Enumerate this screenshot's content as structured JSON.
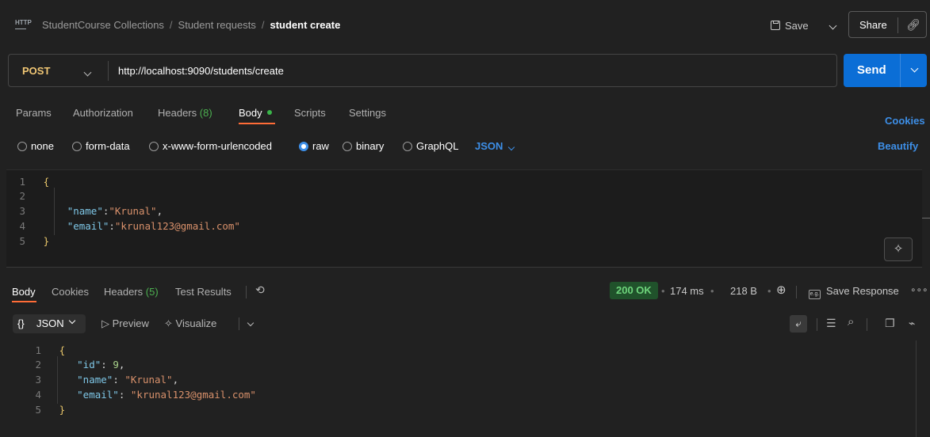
{
  "breadcrumb": {
    "icon_text": "HTTP",
    "collection": "StudentCourse Collections",
    "separator": "/",
    "folder": "Student requests",
    "current": "student create"
  },
  "top_actions": {
    "save_label": "Save",
    "share_label": "Share"
  },
  "request": {
    "method": "POST",
    "url": "http://localhost:9090/students/create",
    "send_label": "Send"
  },
  "request_tabs": [
    {
      "label": "Params"
    },
    {
      "label": "Authorization"
    },
    {
      "label": "Headers",
      "count": "(8)"
    },
    {
      "label": "Body",
      "active": true
    },
    {
      "label": "Scripts"
    },
    {
      "label": "Settings"
    }
  ],
  "cookies_label": "Cookies",
  "body_types": {
    "none": "none",
    "form_data": "form-data",
    "urlencoded": "x-www-form-urlencoded",
    "raw": "raw",
    "binary": "binary",
    "graphql": "GraphQL",
    "selected": "raw",
    "language": "JSON"
  },
  "beautify_label": "Beautify",
  "request_body": {
    "line_numbers": [
      "1",
      "2",
      "3",
      "4",
      "5"
    ],
    "open": "{",
    "close": "}",
    "name_key": "\"name\"",
    "name_value": "\"Krunal\"",
    "email_key": "\"email\"",
    "email_value": "\"krunal123@gmail.com\""
  },
  "response_tabs": [
    {
      "label": "Body",
      "active": true
    },
    {
      "label": "Cookies"
    },
    {
      "label": "Headers",
      "count": "(5)"
    },
    {
      "label": "Test Results"
    }
  ],
  "response_meta": {
    "status": "200 OK",
    "time": "174 ms",
    "size": "218 B",
    "save_response": "Save Response",
    "eg_label": "e.g."
  },
  "response_toolbar": {
    "format": "JSON",
    "format_prefix": "{}",
    "preview": "Preview",
    "visualize": "Visualize"
  },
  "response_body": {
    "line_numbers": [
      "1",
      "2",
      "3",
      "4",
      "5"
    ],
    "open": "{",
    "close": "}",
    "id_key": "\"id\"",
    "id_value": "9",
    "name_key": "\"name\"",
    "name_value": "\"Krunal\"",
    "email_key": "\"email\"",
    "email_value": "\"krunal123@gmail.com\""
  },
  "colors": {
    "background": "#212121",
    "accent_orange": "#ff6c37",
    "send_blue": "#0b6ed6",
    "link_blue": "#3d8fe8",
    "method_yellow": "#f0c674",
    "status_green": "#6ed57c"
  }
}
